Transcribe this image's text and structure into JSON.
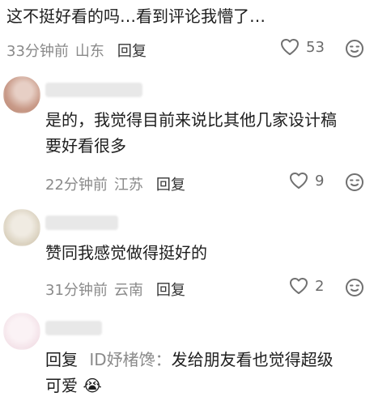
{
  "comments": [
    {
      "text": "这不挺好看的吗…看到评论我懵了…",
      "time": "33分钟前",
      "location": "山东",
      "reply_label": "回复",
      "likes": "53",
      "avatar_color": "#d7b3a3"
    },
    {
      "text_line1": "是的，我觉得目前来说比其他几家设计稿",
      "text_line2": "要好看很多",
      "time": "22分钟前",
      "location": "江苏",
      "reply_label": "回复",
      "likes": "9",
      "avatar_color": "#d9bcb0"
    },
    {
      "text": "赞同我感觉做得挺好的",
      "time": "31分钟前",
      "location": "云南",
      "reply_label": "回复",
      "likes": "2",
      "avatar_color": "#e6e0d2"
    },
    {
      "reply_prefix": "回复",
      "mention": "ID妤楮馋：",
      "text_line1": "发给朋友看也觉得超级",
      "text_line2": "可爱",
      "avatar_color": "#f2e6ea",
      "emoji": "😭"
    }
  ],
  "icons": {
    "like": "heart-outline-icon",
    "emoji": "smile-emoji-icon"
  }
}
